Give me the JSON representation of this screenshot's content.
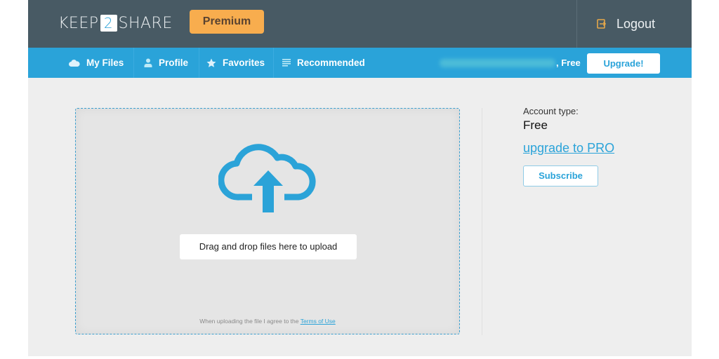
{
  "header": {
    "logo": {
      "left": "KEEP",
      "middle": "2",
      "right": "SHARE"
    },
    "premium_label": "Premium",
    "logout_label": "Logout",
    "logout_icon": "logout-icon"
  },
  "nav": {
    "items": [
      {
        "label": "My Files",
        "icon": "cloud-icon"
      },
      {
        "label": "Profile",
        "icon": "user-icon"
      },
      {
        "label": "Favorites",
        "icon": "star-icon"
      },
      {
        "label": "Recommended",
        "icon": "list-icon"
      }
    ],
    "user_plan": ", Free",
    "upgrade_label": "Upgrade!"
  },
  "upload": {
    "icon": "cloud-upload-icon",
    "drop_label": "Drag and drop files here to upload",
    "terms_text": "When uploading the file I agree to the ",
    "terms_link": "Terms of Use"
  },
  "account": {
    "type_label": "Account type:",
    "type_value": "Free",
    "upgrade_link": "upgrade to PRO",
    "subscribe_label": "Subscribe"
  },
  "colors": {
    "header_bg": "#485a64",
    "nav_bg": "#2aa3d9",
    "premium": "#f8ad4e",
    "accent": "#2aa3d9"
  }
}
